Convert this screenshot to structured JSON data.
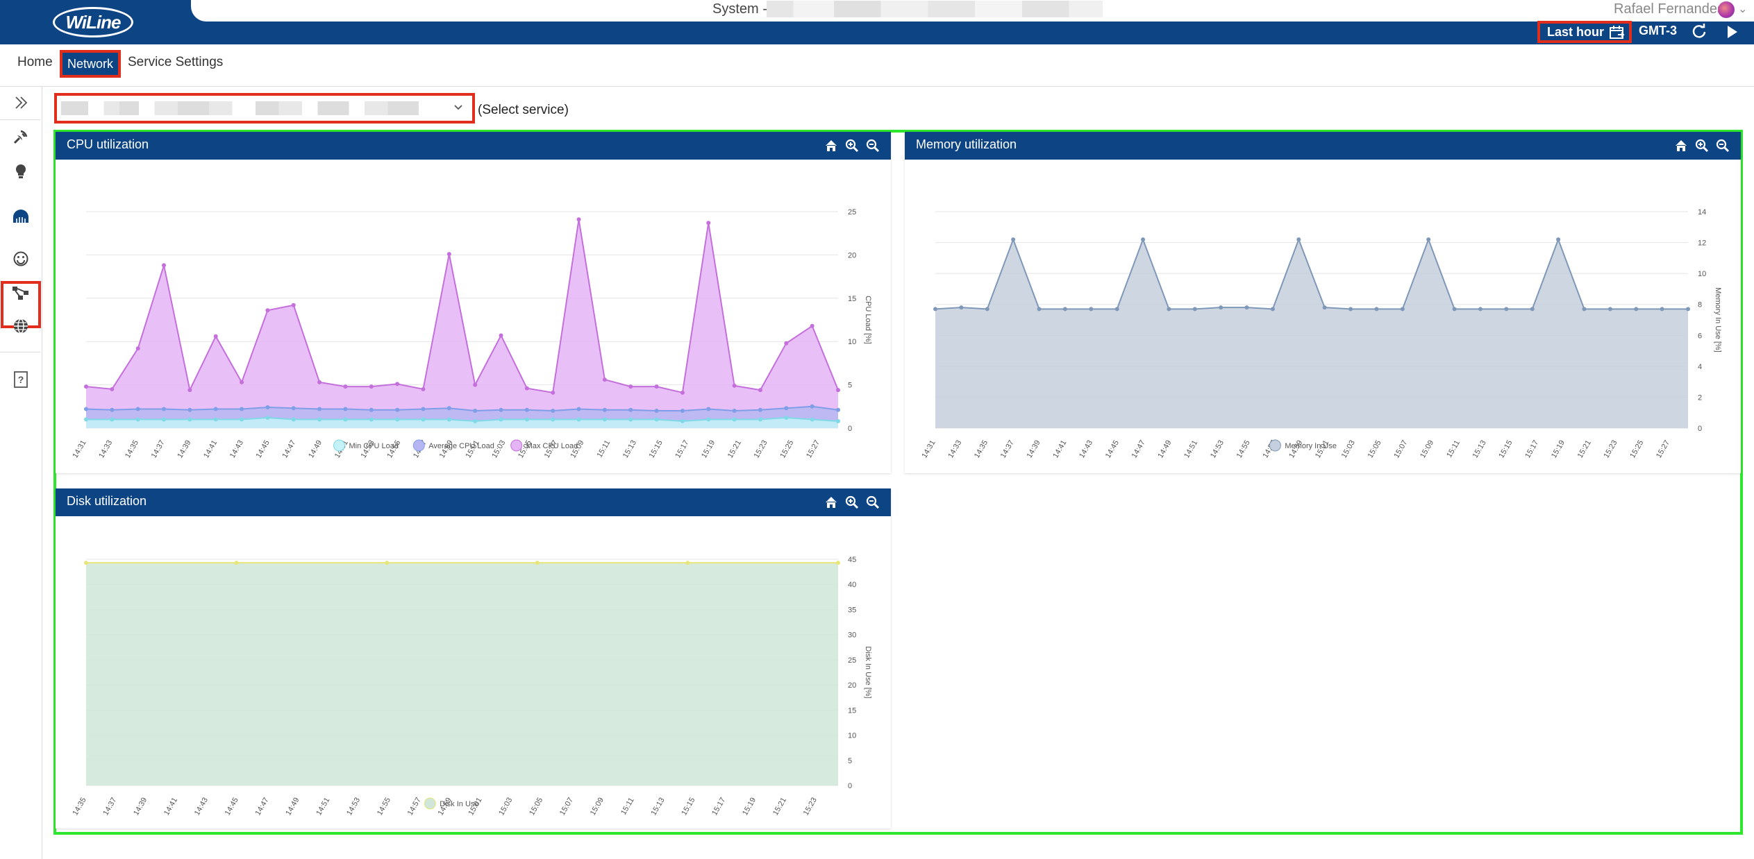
{
  "header": {
    "logo": "WiLine",
    "system_label": "System -",
    "user_name": "Rafael Fernandes",
    "time_range": "Last hour",
    "timezone": "GMT-3"
  },
  "menu": {
    "home": "Home",
    "network": "Network",
    "service_settings": "Service Settings"
  },
  "service_selector": {
    "hint": "(Select service)"
  },
  "panels": {
    "cpu_title": "CPU utilization",
    "memory_title": "Memory utilization",
    "disk_title": "Disk utilization"
  },
  "colors": {
    "brand": "#0d4484",
    "highlight_red": "#e02d1c",
    "highlight_green": "#2ee62e"
  },
  "icons": {
    "sidebar": [
      "expand-icon",
      "satellite-icon",
      "lightbulb-icon",
      "network-card-icon",
      "smiley-icon",
      "topology-icon",
      "globe-icon",
      "help-icon"
    ],
    "panel_tools": [
      "home-icon",
      "zoom-in-icon",
      "zoom-out-icon"
    ]
  },
  "chart_data": [
    {
      "type": "area",
      "title": "CPU utilization",
      "ylabel": "CPU Load [%]",
      "ylim": [
        0,
        25
      ],
      "yticks": [
        0,
        5,
        10,
        15,
        20,
        25
      ],
      "x_tick_labels": [
        "14:31",
        "14:33",
        "14:35",
        "14:37",
        "14:39",
        "14:41",
        "14:43",
        "14:45",
        "14:47",
        "14:49",
        "14:51",
        "14:53",
        "14:55",
        "14:57",
        "14:59",
        "15:01",
        "15:03",
        "15:05",
        "15:07",
        "15:09",
        "15:11",
        "15:13",
        "15:15",
        "15:17",
        "15:19",
        "15:21",
        "15:23",
        "15:25",
        "15:27"
      ],
      "legend_position": "bottom",
      "series": [
        {
          "name": "Min CPU Load",
          "color": "#c4f2f7",
          "values": [
            1,
            1,
            1,
            1,
            1,
            1,
            1,
            1.2,
            1,
            1,
            1,
            1,
            1,
            1,
            1,
            0.8,
            1,
            1,
            1,
            1,
            1,
            1,
            1,
            0.8,
            1,
            1,
            1,
            1.2,
            1,
            0.8
          ]
        },
        {
          "name": "Average CPU Load",
          "color": "#b6b6f2",
          "values": [
            2.2,
            2.1,
            2.2,
            2.2,
            2.1,
            2.2,
            2.2,
            2.4,
            2.3,
            2.2,
            2.2,
            2.1,
            2.1,
            2.2,
            2.3,
            2.0,
            2.1,
            2.1,
            2.0,
            2.2,
            2.1,
            2.1,
            2.0,
            2.0,
            2.2,
            2.0,
            2.1,
            2.3,
            2.5,
            2.1
          ]
        },
        {
          "name": "Max CPU Load",
          "color": "#e4b4f4",
          "values": [
            4.8,
            4.5,
            9.2,
            18.8,
            4.4,
            10.6,
            5.3,
            13.6,
            14.2,
            5.3,
            4.8,
            4.8,
            5.1,
            4.5,
            20.1,
            5.0,
            10.7,
            4.6,
            4.1,
            24.1,
            5.6,
            4.8,
            4.8,
            4.1,
            23.7,
            4.9,
            4.4,
            9.8,
            11.8,
            4.4
          ]
        }
      ]
    },
    {
      "type": "area",
      "title": "Memory utilization",
      "ylabel": "Memory In Use [%]",
      "ylim": [
        0,
        14
      ],
      "yticks": [
        0,
        2,
        4,
        6,
        8,
        10,
        12,
        14
      ],
      "x_tick_labels": [
        "14:31",
        "14:33",
        "14:35",
        "14:37",
        "14:39",
        "14:41",
        "14:43",
        "14:45",
        "14:47",
        "14:49",
        "14:51",
        "14:53",
        "14:55",
        "14:57",
        "14:59",
        "15:01",
        "15:03",
        "15:05",
        "15:07",
        "15:09",
        "15:11",
        "15:13",
        "15:15",
        "15:17",
        "15:19",
        "15:21",
        "15:23",
        "15:25",
        "15:27"
      ],
      "legend_position": "bottom",
      "series": [
        {
          "name": "Memory In Use",
          "color": "#c5cfdd",
          "values": [
            7.7,
            7.8,
            7.7,
            12.2,
            7.7,
            7.7,
            7.7,
            7.7,
            12.2,
            7.7,
            7.7,
            7.8,
            7.8,
            7.7,
            12.2,
            7.8,
            7.7,
            7.7,
            7.7,
            12.2,
            7.7,
            7.7,
            7.7,
            7.7,
            12.2,
            7.7,
            7.7,
            7.7,
            7.7,
            7.7
          ]
        }
      ]
    },
    {
      "type": "area",
      "title": "Disk utilization",
      "ylabel": "Disk In Use [%]",
      "ylim": [
        0,
        45
      ],
      "yticks": [
        0,
        5,
        10,
        15,
        20,
        25,
        30,
        35,
        40,
        45
      ],
      "x_tick_labels": [
        "14:35",
        "14:37",
        "14:39",
        "14:41",
        "14:43",
        "14:45",
        "14:47",
        "14:49",
        "14:51",
        "14:53",
        "14:55",
        "14:57",
        "14:59",
        "15:01",
        "15:03",
        "15:05",
        "15:07",
        "15:09",
        "15:11",
        "15:13",
        "15:15",
        "15:17",
        "15:19",
        "15:21",
        "15:23"
      ],
      "legend_position": "bottom",
      "series": [
        {
          "name": "Disk In Use",
          "color": "#cfe6d8",
          "values": [
            44.3,
            44.3,
            44.3,
            44.3,
            44.3,
            44.3
          ]
        }
      ]
    }
  ]
}
